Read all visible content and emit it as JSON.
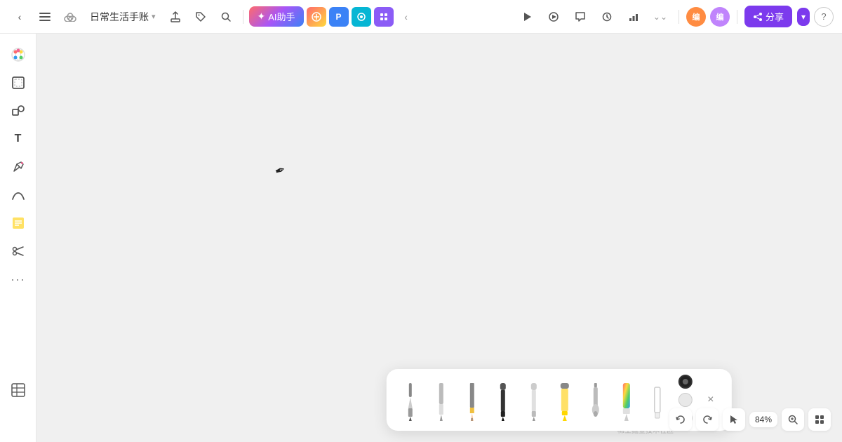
{
  "header": {
    "back_label": "‹",
    "menu_label": "☰",
    "cloud_label": "☁",
    "doc_title": "日常生活手账",
    "title_arrow": "▾",
    "export_label": "⬆",
    "tag_label": "⬡",
    "search_label": "⌕",
    "ai_icon": "✦",
    "ai_label": "AI助手",
    "plugin1": "🌈",
    "plugin2": "P",
    "plugin3": "◎",
    "plugin4": "▣",
    "more_plugins": "‹",
    "right": {
      "play_label": "▷",
      "comment_label": "💬",
      "history_label": "⏱",
      "table_label": "⊞",
      "more_label": "⌄⌄",
      "avatar1_label": "编",
      "avatar2_label": "编",
      "share_label": "分享",
      "help_label": "?"
    }
  },
  "sidebar": {
    "tools": [
      {
        "name": "color-palette-tool",
        "icon": "🎨",
        "label": "调色板"
      },
      {
        "name": "frame-tool",
        "icon": "⬜",
        "label": "框架"
      },
      {
        "name": "shape-tool",
        "icon": "◎",
        "label": "形状"
      },
      {
        "name": "text-tool",
        "icon": "T",
        "label": "文字"
      },
      {
        "name": "pen-tool",
        "icon": "✏",
        "label": "钢笔"
      },
      {
        "name": "curve-tool",
        "icon": "∿",
        "label": "曲线"
      },
      {
        "name": "sticky-note-tool",
        "icon": "📝",
        "label": "便签"
      },
      {
        "name": "scissors-tool",
        "icon": "✂",
        "label": "剪刀"
      },
      {
        "name": "more-tools",
        "icon": "···",
        "label": "更多"
      }
    ],
    "bottom_tool": {
      "name": "table-tool",
      "icon": "⊞",
      "label": "表格"
    }
  },
  "canvas": {
    "background": "#f0f0f0"
  },
  "bottom_tray": {
    "pens": [
      {
        "name": "fountain-pen",
        "icon": "🖋",
        "label": "钢笔"
      },
      {
        "name": "pen-regular",
        "icon": "✒",
        "label": "钢笔2"
      },
      {
        "name": "pencil",
        "icon": "✏",
        "label": "铅笔"
      },
      {
        "name": "marker-black",
        "icon": "🖊",
        "label": "马克笔黑"
      },
      {
        "name": "marker-white",
        "icon": "🖊",
        "label": "马克笔白"
      },
      {
        "name": "highlighter-yellow",
        "icon": "🖌",
        "label": "荧光笔黄"
      },
      {
        "name": "brush-gray",
        "icon": "🖌",
        "label": "刷子灰"
      },
      {
        "name": "texture-pen",
        "icon": "🖌",
        "label": "纹理笔"
      },
      {
        "name": "blank-pen",
        "icon": "□",
        "label": "空白"
      }
    ],
    "colors": [
      {
        "name": "black-dot",
        "value": "#222222"
      },
      {
        "name": "white-dot",
        "value": "#e0e0e0"
      },
      {
        "name": "red-dot",
        "value": "#e53e3e"
      }
    ],
    "close_label": "×"
  },
  "bottom_right": {
    "undo_label": "↺",
    "redo_label": "↻",
    "pointer_label": "↖",
    "zoom_label": "84%",
    "zoom_icon": "🔍",
    "grid_label": "⊞"
  },
  "watermark": "稀土掘金技术社区"
}
